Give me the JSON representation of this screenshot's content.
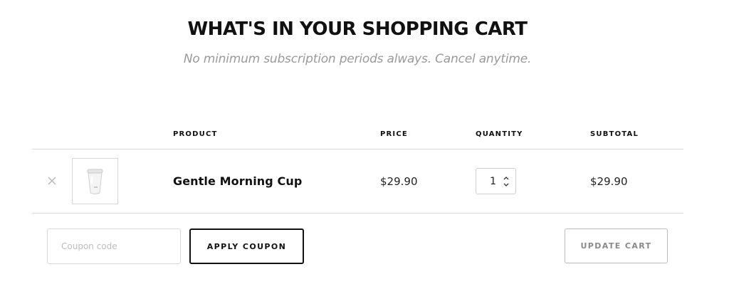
{
  "header": {
    "title": "WHAT'S IN YOUR SHOPPING CART",
    "subtitle": "No minimum subscription periods always. Cancel anytime."
  },
  "table": {
    "columns": {
      "product": "PRODUCT",
      "price": "PRICE",
      "quantity": "QUANTITY",
      "subtotal": "SUBTOTAL"
    },
    "rows": [
      {
        "remove_icon": "close-icon",
        "image_icon": "cup-product-image",
        "product": "Gentle Morning Cup",
        "price": "$29.90",
        "quantity": "1",
        "subtotal": "$29.90"
      }
    ]
  },
  "actions": {
    "coupon_placeholder": "Coupon code",
    "apply_label": "APPLY COUPON",
    "update_label": "UPDATE CART"
  },
  "colors": {
    "text": "#111111",
    "muted": "#9a9a9a",
    "border": "#d8d8d8",
    "update_text": "#8a8a8a"
  }
}
